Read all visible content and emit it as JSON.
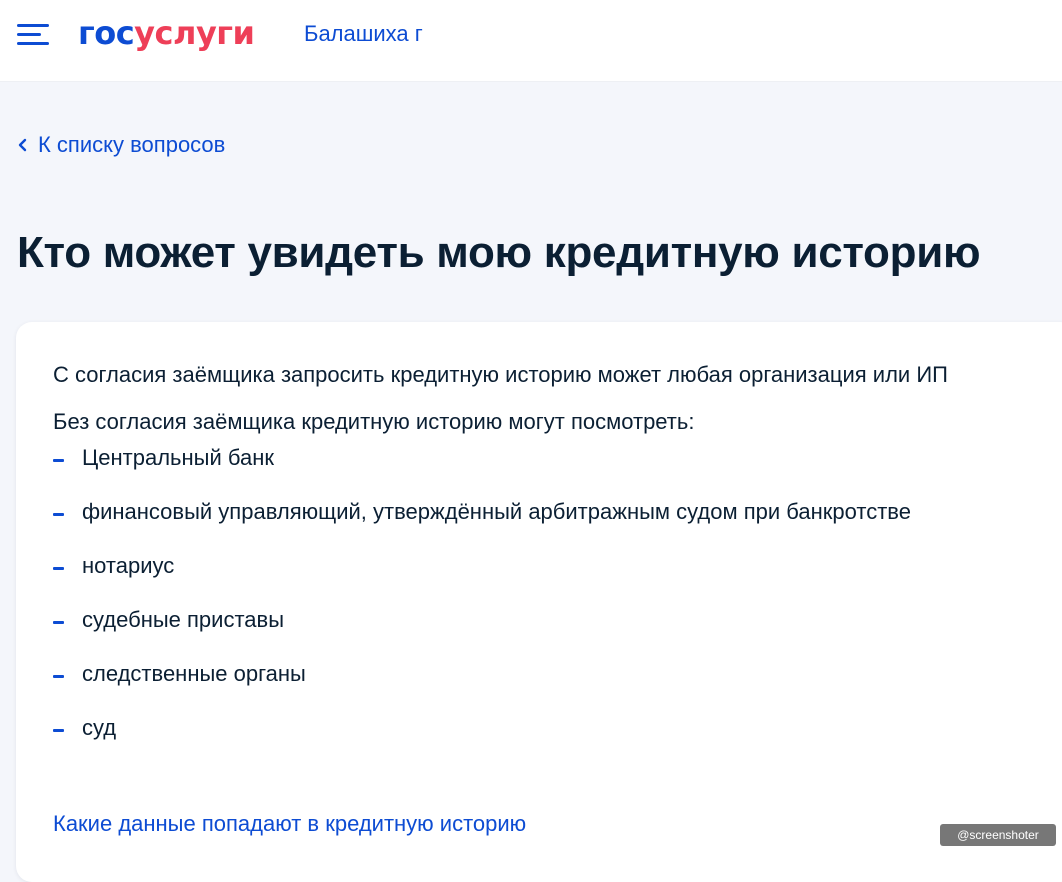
{
  "header": {
    "logo_part1": "гос",
    "logo_part2": "услуги",
    "location": "Балашиха г",
    "menu_icon": "hamburger-menu-icon"
  },
  "nav": {
    "back_label": "К списку вопросов",
    "back_icon": "chevron-left-icon"
  },
  "page": {
    "title": "Кто может увидеть мою кредитную историю"
  },
  "content": {
    "paragraph1": "С согласия заёмщика запросить кредитную историю может любая организация или ИП",
    "paragraph2": "Без согласия заёмщика кредитную историю могут посмотреть:",
    "list": [
      "Центральный банк",
      "финансовый управляющий, утверждённый арбитражным судом при банкротстве",
      "нотариус",
      "судебные приставы",
      "следственные органы",
      "суд"
    ],
    "related_link": "Какие данные попадают в кредитную историю"
  },
  "watermark": "@screenshoter",
  "colors": {
    "primary": "#0d4cd3",
    "logo_red": "#ee3f58",
    "text": "#0b1f33",
    "background": "#f4f6fb"
  }
}
